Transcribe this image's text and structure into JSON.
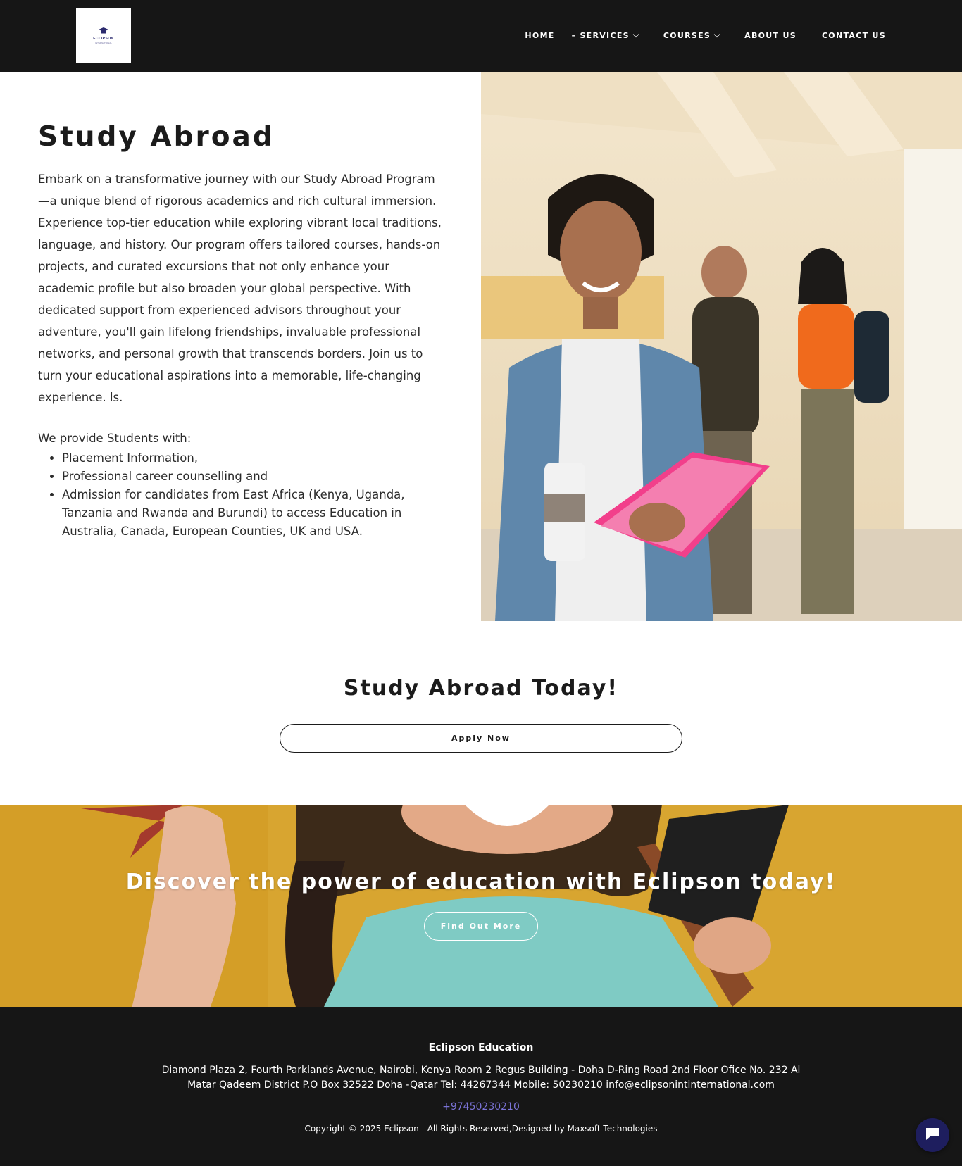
{
  "header": {
    "logo": {
      "name": "ECLIPSON",
      "sub": "INTERNATIONAL"
    },
    "nav": {
      "home": "HOME",
      "services": "SERVICES",
      "courses": "COURSES",
      "about": "ABOUT US",
      "contact": "CONTACT US"
    }
  },
  "hero": {
    "title": "Study Abroad",
    "description": " Embark on a transformative journey with our Study Abroad Program—a unique blend of rigorous academics and rich cultural immersion. Experience top-tier education while exploring vibrant local traditions, language, and history. Our program offers tailored courses, hands-on projects, and curated excursions that not only enhance your academic profile but also broaden your global perspective. With dedicated support from experienced advisors throughout your adventure, you'll gain lifelong friendships, invaluable professional networks, and personal growth that transcends borders. Join us to turn your educational aspirations into a memorable, life-changing experience. ls.",
    "provide_intro": "We provide Students with:",
    "bullets": [
      "Placement Information,",
      "Professional career counselling and",
      "Admission for candidates from East Africa (Kenya, Uganda, Tanzania and Rwanda and Burundi) to access Education in Australia, Canada, European Counties, UK and USA."
    ]
  },
  "cta": {
    "title": "Study Abroad Today!",
    "button": "Apply Now"
  },
  "banner": {
    "title": "Discover the power of education with Eclipson today!",
    "button": "Find Out More"
  },
  "footer": {
    "brand": "Eclipson Education",
    "address": "Diamond Plaza 2, Fourth Parklands Avenue, Nairobi, Kenya Room 2 Regus Building - Doha D-Ring Road 2nd Floor Ofice No. 232 Al Matar Qadeem District P.O Box 32522 Doha -Qatar Tel: 44267344 Mobile: 50230210 info@eclipsonintinternational.com",
    "phone": "+97450230210",
    "copyright": "Copyright © 2025 Eclipson - All Rights Reserved,Designed by Maxsoft Technologies"
  },
  "colors": {
    "header_bg": "#161616",
    "footer_bg": "#161616",
    "link_phone": "#7a73d6",
    "chat_button": "#1e1e5e",
    "banner_bg": "#d9a52c"
  },
  "icons": [
    "graduation-cap-icon",
    "chevron-down-icon",
    "chat-icon"
  ]
}
